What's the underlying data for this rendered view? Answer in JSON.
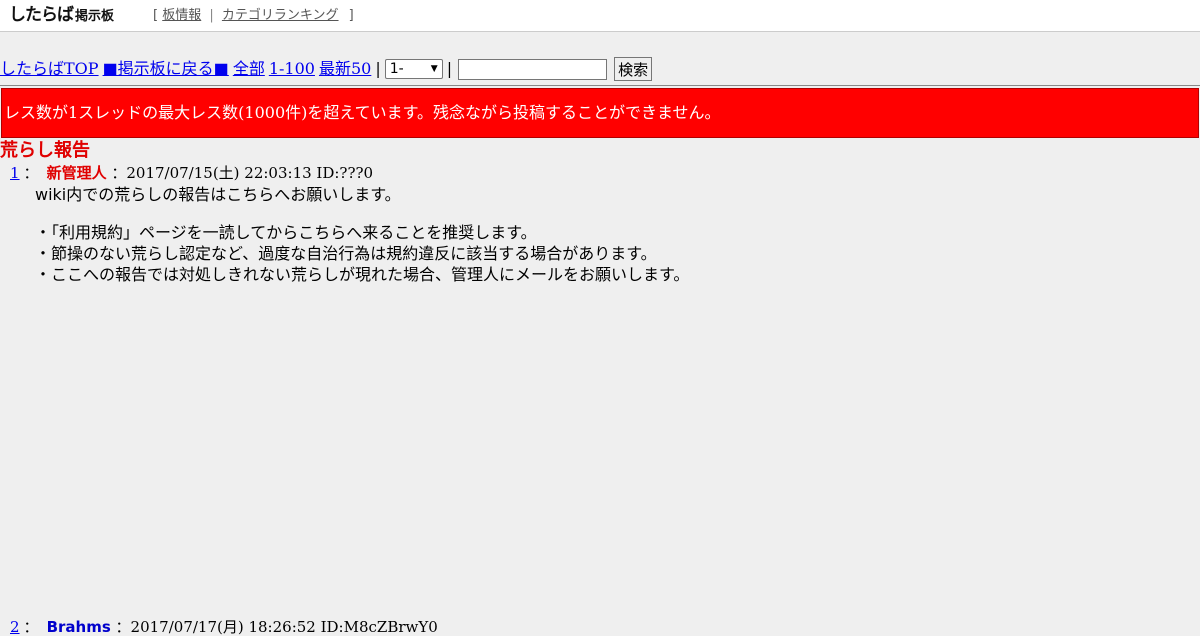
{
  "header": {
    "logo": "したらば",
    "logo_sub": "掲示板",
    "bracket_open": "[",
    "bracket_close": "]",
    "sep": "|",
    "links": [
      "板情報",
      "カテゴリランキング"
    ]
  },
  "nav": {
    "top": "したらばTOP",
    "back": "■掲示板に戻る■",
    "all": "全部",
    "range": "1-100",
    "latest": "最新50",
    "bar": "|",
    "select_value": "1-",
    "search_button": "検索"
  },
  "alert": "レス数が1スレッドの最大レス数(1000件)を超えています。残念ながら投稿することができません。",
  "thread": {
    "title": "荒らし報告",
    "posts": [
      {
        "num": "1",
        "colon": "：",
        "name": "新管理人",
        "meta": "：2017/07/15(土) 22:03:13 ID:???0",
        "lines": [
          "wiki内での荒らしの報告はこちらへお願いします。",
          "・「利用規約」ページを一読してからこちらへ来ることを推奨します。",
          "・節操のない荒らし認定など、過度な自治行為は規約違反に該当する場合があります。",
          "・ここへの報告では対処しきれない荒らしが現れた場合、管理人にメールをお願いします。"
        ]
      },
      {
        "num": "2",
        "colon": "：",
        "name": "Brahms",
        "meta": "：2017/07/17(月) 18:26:52 ID:M8cZBrwY0"
      }
    ]
  },
  "colors": {
    "alert_bg": "#ff0000",
    "title": "#e00000",
    "link": "#0000ee",
    "background": "#efefef"
  }
}
